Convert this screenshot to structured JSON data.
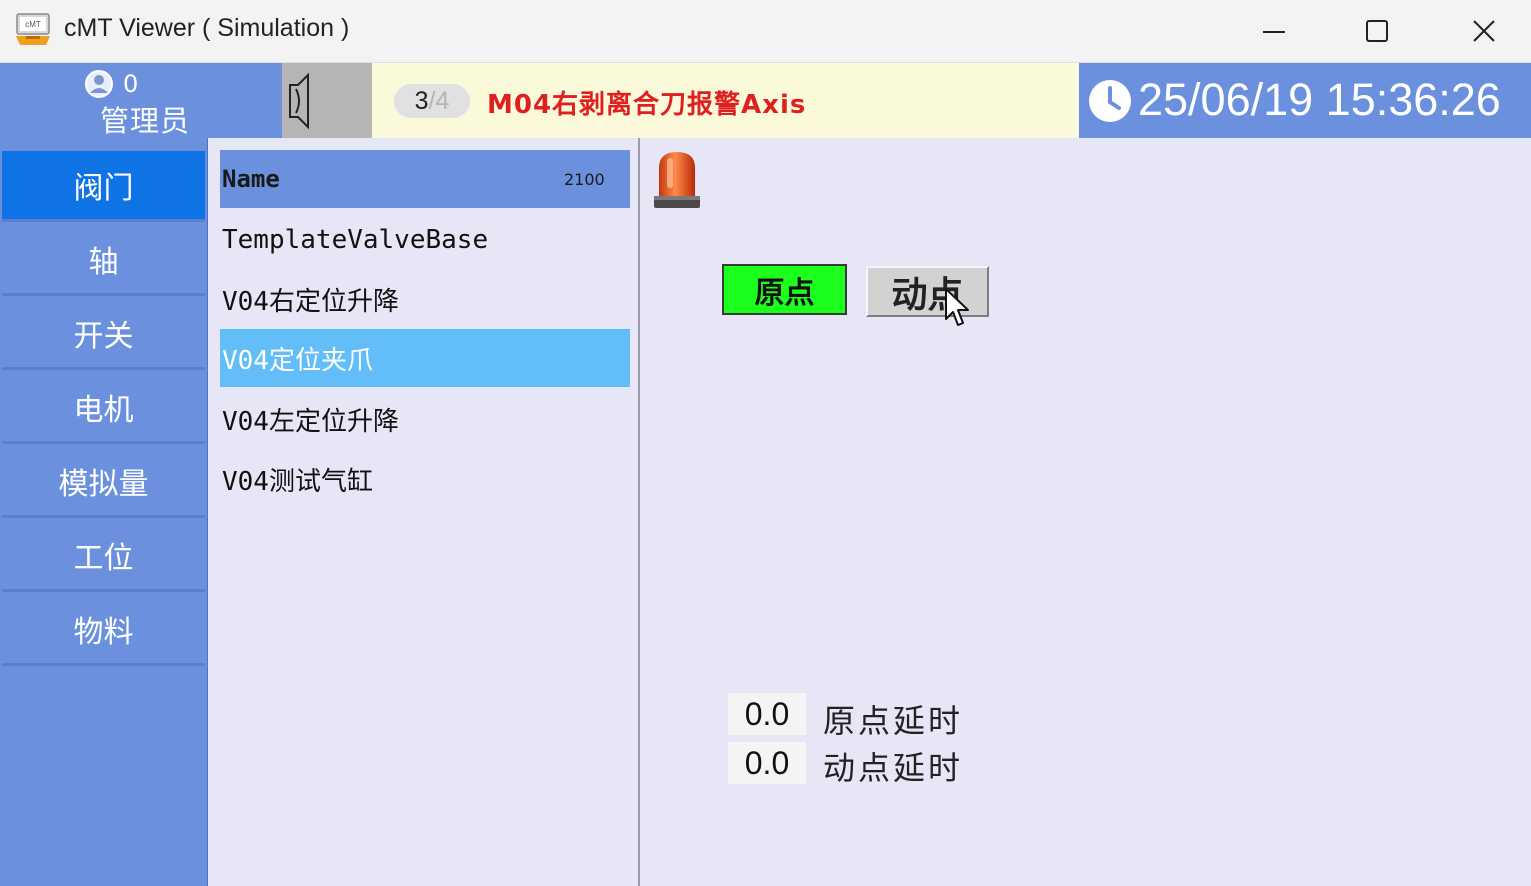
{
  "window": {
    "title": "cMT Viewer ( Simulation )",
    "icon": "cmt-app-icon",
    "controls": [
      "minimize-icon",
      "maximize-icon",
      "close-icon"
    ]
  },
  "header": {
    "user_count": "0",
    "user_role": "管理员",
    "alarm_current": "3",
    "alarm_separator": "/",
    "alarm_total": "4",
    "alarm_message": "M04右剥离合刀报警Axis",
    "datetime": "25/06/19 15:36:26"
  },
  "sidebar": {
    "items": [
      {
        "label": "阀门",
        "active": true
      },
      {
        "label": "轴",
        "active": false
      },
      {
        "label": "开关",
        "active": false
      },
      {
        "label": "电机",
        "active": false
      },
      {
        "label": "模拟量",
        "active": false
      },
      {
        "label": "工位",
        "active": false
      },
      {
        "label": "物料",
        "active": false
      }
    ]
  },
  "list": {
    "header_name": "Name",
    "header_count": "2100",
    "rows": [
      {
        "label": "TemplateValveBase",
        "selected": false
      },
      {
        "label": "V04右定位升降",
        "selected": false
      },
      {
        "label": "V04定位夹爪",
        "selected": true
      },
      {
        "label": "V04左定位升降",
        "selected": false
      },
      {
        "label": "V04测试气缸",
        "selected": false
      }
    ]
  },
  "detail": {
    "home_button": "原点",
    "work_button": "动点",
    "home_delay_value": "0.0",
    "home_delay_label": "原点延时",
    "work_delay_value": "0.0",
    "work_delay_label": "动点延时"
  },
  "colors": {
    "header_blue": "#6b90de",
    "nav_active": "#0f73e6",
    "row_selected": "#62bdf9",
    "alarm_red": "#e02020",
    "home_green": "#1cff1c",
    "alarm_bar_bg": "#fafada",
    "panel_bg": "#e6e6f6"
  }
}
